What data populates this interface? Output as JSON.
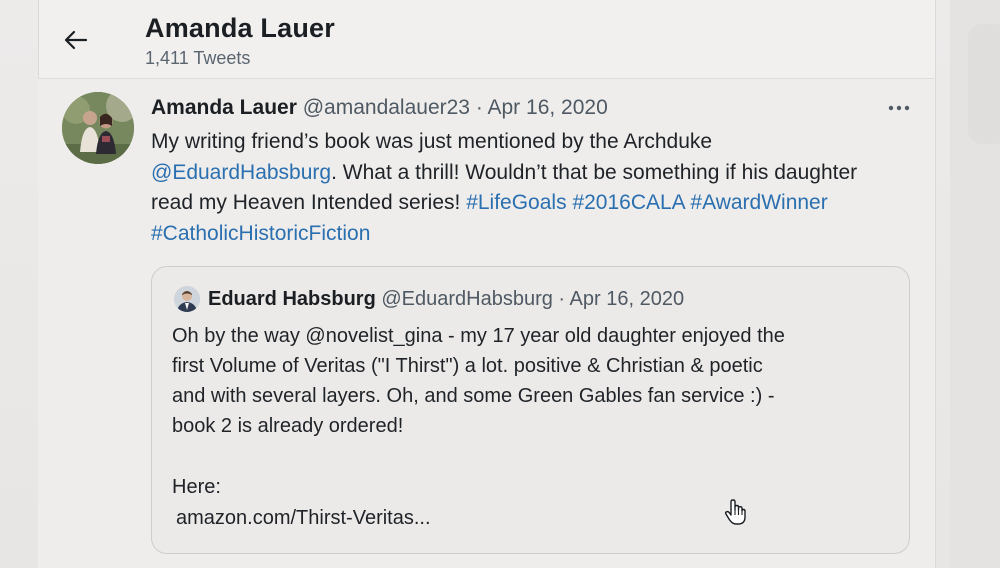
{
  "header": {
    "name": "Amanda Lauer",
    "tweet_count": "1,411 Tweets"
  },
  "tweet": {
    "author_name": "Amanda Lauer",
    "handle": "@amandalauer23",
    "separator": " · ",
    "date": "Apr 16, 2020",
    "text_1": "My writing friend’s book was just mentioned by the Archduke ",
    "mention": "@EduardHabsburg",
    "text_2": ". What a thrill! Wouldn’t that be something if his daughter read my Heaven Intended series! ",
    "hashtags": [
      "#LifeGoals",
      "#2016CALA",
      "#AwardWinner",
      "#CatholicHistoricFiction"
    ]
  },
  "quote": {
    "author_name": "Eduard Habsburg",
    "handle": "@EduardHabsburg",
    "separator": " · ",
    "date": "Apr 16, 2020",
    "lines": [
      "Oh by the way @novelist_gina - my 17 year old daughter enjoyed the",
      "first Volume of Veritas (\"I Thirst\") a lot. positive & Christian & poetic",
      "and with several layers. Oh, and some Green Gables fan service :) -",
      "book 2 is already ordered!"
    ],
    "here_label": "Here:",
    "link_text": "amazon.com/Thirst-Veritas..."
  },
  "icons": {
    "back": "arrow-left-icon",
    "more": "more-horizontal-icon",
    "cursor": "hand-pointer-icon"
  },
  "colors": {
    "link": "#2a6fb0",
    "text": "#1f2328",
    "muted": "#5b6570"
  }
}
